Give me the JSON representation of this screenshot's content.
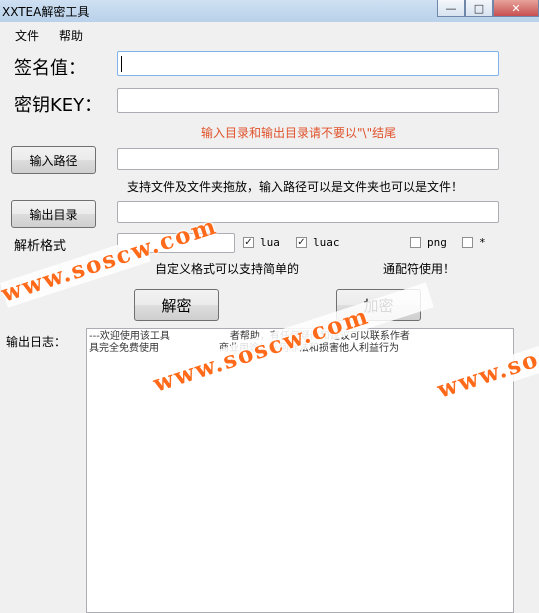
{
  "window": {
    "title": "XXTEA解密工具",
    "buttons": {
      "minimize": "—",
      "maximize": "□",
      "close": "✕"
    }
  },
  "menu": {
    "file": "文件",
    "help": "帮助"
  },
  "form": {
    "sign_label": "签名值：",
    "sign_value": "",
    "key_label": "密钥KEY：",
    "key_value": "",
    "path_warning": "输入目录和输出目录请不要以\"\\\"结尾",
    "input_path_button": "输入路径",
    "input_path_value": "",
    "drag_hint": "支持文件及文件夹拖放，输入路径可以是文件夹也可以是文件！",
    "output_dir_button": "输出目录",
    "output_dir_value": "",
    "format_label": "解析格式",
    "format_value": "",
    "formats": [
      {
        "label": "lua",
        "checked": true
      },
      {
        "label": "luac",
        "checked": true
      },
      {
        "label": "png",
        "checked": false
      },
      {
        "label": "*",
        "checked": false
      }
    ],
    "custom_hint_part1": "自定义格式可以支持简单的",
    "custom_hint_part2": "通配符使用！",
    "decrypt_button": "解密",
    "encrypt_button": "加密",
    "log_label": "输出日志：",
    "log_lines": [
      "---欢迎使用该工具",
      "具完全免费使用",
      "者帮助，有任何疑问和建议可以联系作者",
      "商业用途！任何非法和损害他人利益行为"
    ]
  },
  "watermark": {
    "text": "www.soscw.com",
    "color": "#ff6a1a"
  }
}
